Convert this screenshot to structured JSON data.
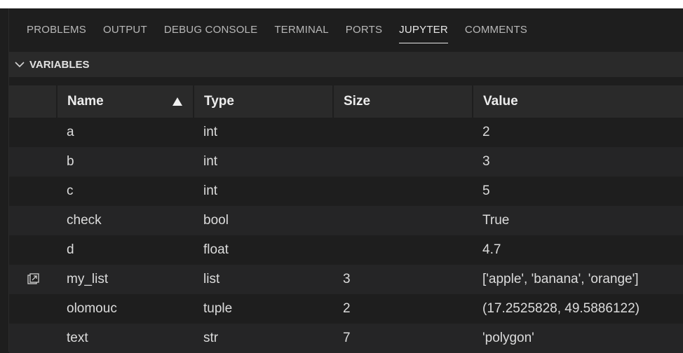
{
  "tabs": [
    {
      "label": "PROBLEMS",
      "active": false
    },
    {
      "label": "OUTPUT",
      "active": false
    },
    {
      "label": "DEBUG CONSOLE",
      "active": false
    },
    {
      "label": "TERMINAL",
      "active": false
    },
    {
      "label": "PORTS",
      "active": false
    },
    {
      "label": "JUPYTER",
      "active": true
    },
    {
      "label": "COMMENTS",
      "active": false
    }
  ],
  "section": {
    "title": "VARIABLES",
    "icon": "chevron-down-icon"
  },
  "table": {
    "headers": {
      "name": "Name",
      "type": "Type",
      "size": "Size",
      "value": "Value"
    },
    "sort": {
      "column": "Name",
      "icon": "sort-up-triangle-icon"
    },
    "rows": [
      {
        "name": "a",
        "type": "int",
        "size": "",
        "value": "2",
        "icon": ""
      },
      {
        "name": "b",
        "type": "int",
        "size": "",
        "value": "3",
        "icon": ""
      },
      {
        "name": "c",
        "type": "int",
        "size": "",
        "value": "5",
        "icon": ""
      },
      {
        "name": "check",
        "type": "bool",
        "size": "",
        "value": "True",
        "icon": ""
      },
      {
        "name": "d",
        "type": "float",
        "size": "",
        "value": "4.7",
        "icon": ""
      },
      {
        "name": "my_list",
        "type": "list",
        "size": "3",
        "value": "['apple', 'banana', 'orange']",
        "icon": "open-in-data-viewer-icon"
      },
      {
        "name": "olomouc",
        "type": "tuple",
        "size": "2",
        "value": "(17.2525828, 49.5886122)",
        "icon": ""
      },
      {
        "name": "text",
        "type": "str",
        "size": "7",
        "value": "'polygon'",
        "icon": ""
      }
    ]
  },
  "colors": {
    "background": "#1e1e1e",
    "header_bg": "#2a2a2a",
    "alt_row": "#252526",
    "text": "#dcdcdc",
    "tab_inactive": "#b8b8b8"
  }
}
